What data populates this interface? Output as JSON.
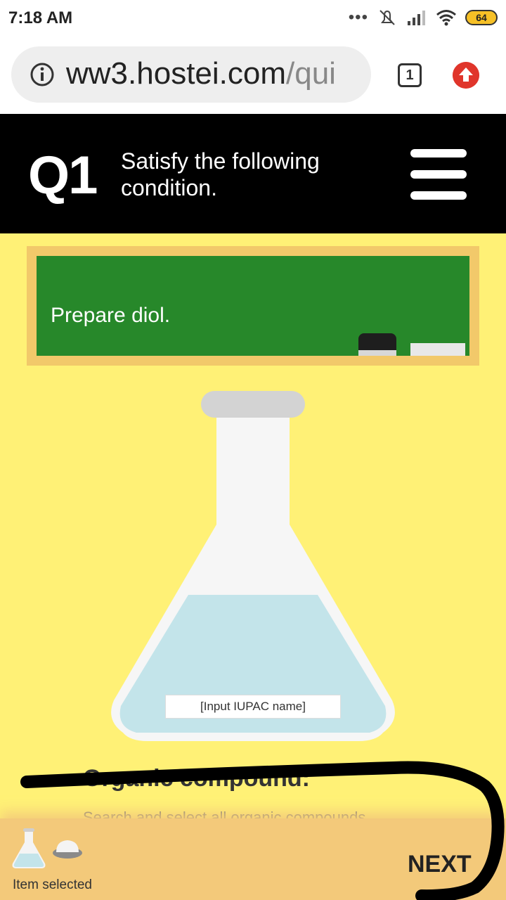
{
  "status_bar": {
    "time": "7:18 AM",
    "dots": "•••",
    "battery": "64",
    "icons": [
      "mute-icon",
      "signal-icon",
      "wifi-icon",
      "battery-icon"
    ]
  },
  "browser": {
    "url_host": "ww3.hostei.com",
    "url_path": "/qui",
    "tab_count": "1",
    "icons": [
      "info-icon",
      "tabs-icon",
      "upload-icon"
    ]
  },
  "question": {
    "number": "Q1",
    "prompt": "Satisfy the following condition."
  },
  "board": {
    "text": "Prepare diol."
  },
  "flask": {
    "input_placeholder": "[Input IUPAC name]"
  },
  "organic": {
    "title": "Organic compound:",
    "subtitle": "Search and select all organic compounds"
  },
  "bottom_bar": {
    "status": "Item selected",
    "next_label": "NEXT"
  },
  "colors": {
    "background": "#fff176",
    "board": "#27882a",
    "frame": "#f2c96a",
    "liquid": "#c3e4ea",
    "bottom_bar": "#f3c97a",
    "upload": "#e0352b"
  }
}
